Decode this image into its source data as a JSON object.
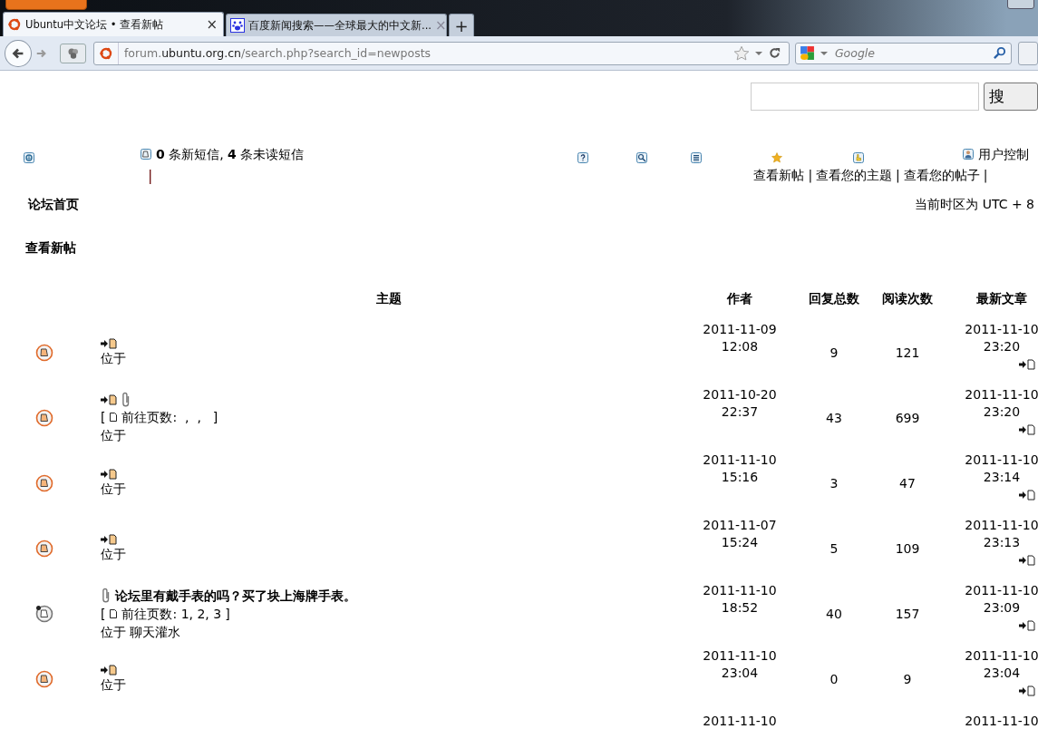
{
  "browser": {
    "tabs": [
      {
        "title": "Ubuntu中文论坛 • 查看新帖",
        "selected": true,
        "kind": "ubuntu"
      },
      {
        "title": "百度新闻搜索——全球最大的中文新...",
        "selected": false,
        "kind": "paw"
      }
    ],
    "new_tab": "+",
    "close": "×",
    "url": [
      {
        "text": "forum.",
        "strong": false
      },
      {
        "text": "ubuntu.org.cn",
        "strong": true
      },
      {
        "text": "/search.php?search_id=newposts",
        "strong": false
      }
    ],
    "search_placeholder": "Google"
  },
  "page": {
    "search_button": "搜",
    "nav_icons": [
      {
        "kind": "register"
      },
      {
        "kind": "messages",
        "parts": [
          {
            "text": "0",
            "bold": true
          },
          {
            "text": " 条新短信, ",
            "bold": false
          },
          {
            "text": "4",
            "bold": true
          },
          {
            "text": " 条未读短信",
            "bold": false
          }
        ]
      },
      {
        "kind": "faq"
      },
      {
        "kind": "search"
      },
      {
        "kind": "members"
      },
      {
        "kind": "star"
      },
      {
        "kind": "hand"
      },
      {
        "kind": "user",
        "label": "用户控制"
      }
    ],
    "left_separator": "|",
    "links": [
      {
        "label": "查看新帖",
        "separator": "|"
      },
      {
        "label": "查看您的主题",
        "separator": "|"
      },
      {
        "label": "查看您的帖子",
        "separator": "|"
      }
    ],
    "breadcrumb": "论坛首页",
    "timezone": "当前时区为 UTC + 8",
    "heading": "查看新帖",
    "table": {
      "columns": [
        "主题",
        "作者",
        "回复总数",
        "阅读次数",
        "最新文章"
      ],
      "rows": [
        {
          "kind": "unread",
          "unread_link": true,
          "attachment": false,
          "location": "位于",
          "first_post": {
            "date": "2011-11-09",
            "time": "12:08"
          },
          "replies": "9",
          "views": "121",
          "last_post": {
            "date": "2011-11-10",
            "time": "23:20"
          }
        },
        {
          "kind": "unread",
          "unread_link": true,
          "attachment": true,
          "pages": {
            "open": "[",
            "label": "前往页数:  ,  ,  ",
            "close": "]"
          },
          "location": "位于",
          "first_post": {
            "date": "2011-10-20",
            "time": "22:37"
          },
          "replies": "43",
          "views": "699",
          "last_post": {
            "date": "2011-11-10",
            "time": "23:20"
          }
        },
        {
          "kind": "unread",
          "unread_link": true,
          "attachment": false,
          "location": "位于",
          "first_post": {
            "date": "2011-11-10",
            "time": "15:16"
          },
          "replies": "3",
          "views": "47",
          "last_post": {
            "date": "2011-11-10",
            "time": "23:14"
          }
        },
        {
          "kind": "unread",
          "unread_link": true,
          "attachment": false,
          "location": "位于",
          "first_post": {
            "date": "2011-11-07",
            "time": "15:24"
          },
          "replies": "5",
          "views": "109",
          "last_post": {
            "date": "2011-11-10",
            "time": "23:13"
          }
        },
        {
          "kind": "read_mine",
          "unread_link": false,
          "attachment": true,
          "title": "论坛里有戴手表的吗？买了块上海牌手表。",
          "pages": {
            "open": "[",
            "label": "前往页数: 1, 2, 3",
            "close": "]"
          },
          "location": "位于",
          "forum": "聊天灌水",
          "first_post": {
            "date": "2011-11-10",
            "time": "18:52"
          },
          "replies": "40",
          "views": "157",
          "last_post": {
            "date": "2011-11-10",
            "time": "23:09"
          }
        },
        {
          "kind": "unread",
          "unread_link": true,
          "attachment": false,
          "location": "位于",
          "first_post": {
            "date": "2011-11-10",
            "time": "23:04"
          },
          "replies": "0",
          "views": "9",
          "last_post": {
            "date": "2011-11-10",
            "time": "23:04"
          }
        },
        {
          "first_post": {
            "date": "2011-11-10"
          },
          "last_post": {
            "date": "2011-11-10"
          }
        }
      ]
    }
  }
}
